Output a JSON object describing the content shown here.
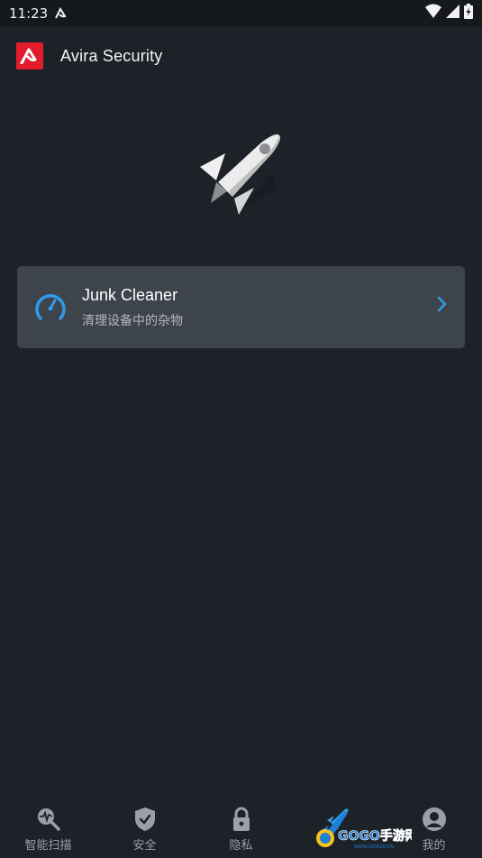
{
  "status_bar": {
    "time": "11:23",
    "icons": [
      "avira-notification-icon",
      "wifi-icon",
      "cell-signal-icon",
      "battery-charging-icon"
    ]
  },
  "app_bar": {
    "title": "Avira Security",
    "brand_color": "#e21b2d"
  },
  "hero": {
    "icon": "rocket-icon"
  },
  "card": {
    "title": "Junk Cleaner",
    "subtitle": "清理设备中的杂物",
    "icon": "speedometer-icon",
    "accent_color": "#2f9be8"
  },
  "bottom_nav": {
    "items": [
      {
        "label": "智能扫描",
        "icon": "smart-scan-icon"
      },
      {
        "label": "安全",
        "icon": "shield-check-icon"
      },
      {
        "label": "隐私",
        "icon": "lock-icon"
      },
      {
        "label": "",
        "icon": "rocket-icon"
      },
      {
        "label": "我的",
        "icon": "account-icon"
      }
    ]
  },
  "watermark": {
    "text": "GOGO手游网",
    "url_text": "WWW.GOGOO.CN"
  }
}
